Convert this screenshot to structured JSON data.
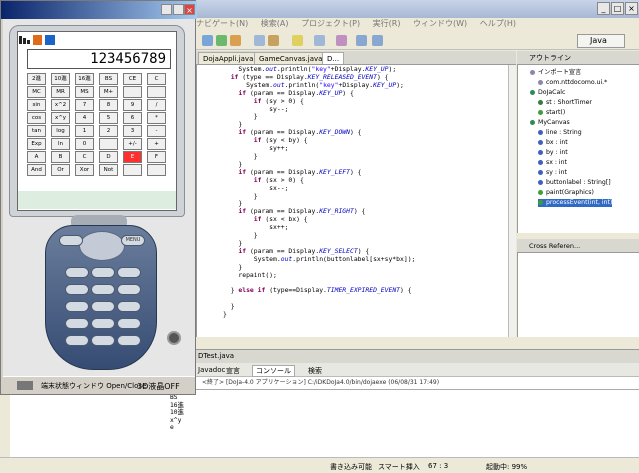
{
  "ide": {
    "menu": [
      "ナビゲート(N)",
      "検索(A)",
      "プロジェクト(P)",
      "実行(R)",
      "ウィンドウ(W)",
      "ヘルプ(H)"
    ],
    "perspective": "Java",
    "editor_tabs": [
      "DojaAppli.java",
      "GameCanvas.java",
      "D..."
    ],
    "outline_title": "アウトライン",
    "outline_items": [
      {
        "label": "インポート宣言",
        "color": "#8888aa"
      },
      {
        "label": "com.nttdocomo.ui.*",
        "color": "#8888aa"
      },
      {
        "label": "DoJaCalc",
        "color": "#2e8b57"
      },
      {
        "label": "st : ShortTimer",
        "color": "#3a7a3a"
      },
      {
        "label": "start()",
        "color": "#3aa03a"
      },
      {
        "label": "MyCanvas",
        "color": "#2e8b57"
      },
      {
        "label": "line : String",
        "color": "#4060c0"
      },
      {
        "label": "bx : int",
        "color": "#4060c0"
      },
      {
        "label": "by : int",
        "color": "#4060c0"
      },
      {
        "label": "sx : int",
        "color": "#4060c0"
      },
      {
        "label": "sy : int",
        "color": "#4060c0"
      },
      {
        "label": "buttonlabel : String[]",
        "color": "#4060c0"
      },
      {
        "label": "paint(Graphics)",
        "color": "#3aa03a"
      },
      {
        "label": "processEvent(int, int)",
        "color": "#3aa03a"
      }
    ],
    "cross_ref_title": "Cross Referen...",
    "console_tabs": {
      "javadoc": "Javadoc",
      "decl": "宣言",
      "console": "コンソール",
      "search": "検索"
    },
    "bottom_tab": "DTest.java",
    "console_info": "<終了> [DoJa-4.0 アプリケーション] C:/iDKDoJa4.0/bin/dojaexe (06/08/31 17:49)",
    "console_lines": [
      "BS",
      "16進",
      "10進",
      "x^y",
      "e"
    ],
    "status": {
      "writable": "書き込み可能",
      "insert": "スマート挿入",
      "pos": "67 : 3",
      "launch": "起動中: 99%"
    }
  },
  "code_lines": [
    "    System.out.println(\"key\"+Display.KEY_UP);",
    "  if (type == Display.KEY_RELEASED_EVENT) {",
    "      System.out.println(\"key\"+Display.KEY_UP);",
    "    if (param == Display.KEY_UP) {",
    "        if (sy > 0) {",
    "            sy--;",
    "        }",
    "    }",
    "    if (param == Display.KEY_DOWN) {",
    "        if (sy < by) {",
    "            sy++;",
    "        }",
    "    }",
    "    if (param == Display.KEY_LEFT) {",
    "        if (sx > 0) {",
    "            sx--;",
    "        }",
    "    }",
    "    if (param == Display.KEY_RIGHT) {",
    "        if (sx < bx) {",
    "            sx++;",
    "        }",
    "    }",
    "    if (param == Display.KEY_SELECT) {",
    "        System.out.println(buttonlabel[sx+sy*bx]);",
    "    }",
    "    repaint();",
    "",
    "  } else if (type==Display.TIMER_EXPIRED_EVENT) {",
    "",
    "  }",
    "}"
  ],
  "emulator": {
    "display_value": "123456789",
    "keys": [
      [
        "2進",
        "10進",
        "16進",
        "BS",
        "CE",
        "C"
      ],
      [
        "MC",
        "MR",
        "MS",
        "M+",
        "",
        ""
      ],
      [
        "sin",
        "x^2",
        "7",
        "8",
        "9",
        "/"
      ],
      [
        "cos",
        "x^y",
        "4",
        "5",
        "6",
        "*"
      ],
      [
        "tan",
        "log",
        "1",
        "2",
        "3",
        "-"
      ],
      [
        "Exp",
        "ln",
        "0",
        "",
        "+/-",
        "+"
      ],
      [
        "A",
        "B",
        "C",
        "D",
        "E",
        "F"
      ],
      [
        "And",
        "Or",
        "Xor",
        "Not",
        "",
        ""
      ]
    ],
    "highlight_key": "E",
    "bottom_label": "端末状態ウィンドウ Open/Close",
    "lcd_label": "3D液晶OFF",
    "menu_key": "MENU"
  },
  "colors": {
    "keyword": "#7f0055",
    "string": "#2a00ff",
    "constant": "#0000c0",
    "highlight": "#ff3030"
  }
}
